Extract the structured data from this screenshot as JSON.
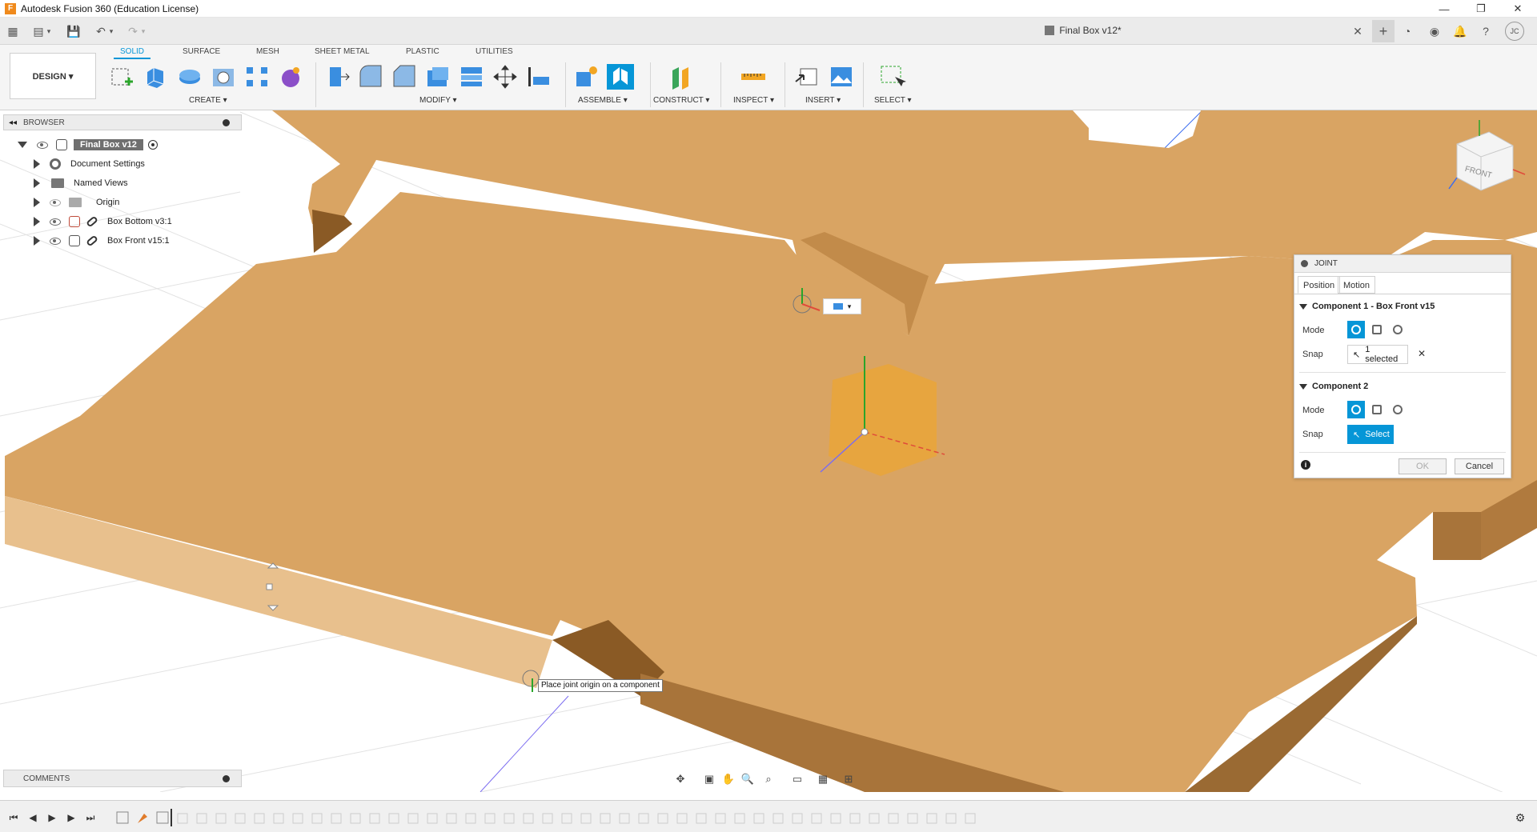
{
  "window": {
    "app_title": "Autodesk Fusion 360 (Education License)",
    "app_icon": "F"
  },
  "document": {
    "title": "Final Box v12*"
  },
  "ribbon": {
    "workspace": "DESIGN ▾",
    "tabs": [
      "SOLID",
      "SURFACE",
      "MESH",
      "SHEET METAL",
      "PLASTIC",
      "UTILITIES"
    ],
    "active_tab": "SOLID",
    "groups": {
      "create": "CREATE ▾",
      "modify": "MODIFY ▾",
      "assemble": "ASSEMBLE ▾",
      "construct": "CONSTRUCT ▾",
      "inspect": "INSPECT ▾",
      "insert": "INSERT ▾",
      "select": "SELECT ▾"
    },
    "accent": "#0696d7"
  },
  "browser": {
    "header": "BROWSER",
    "root": "Final Box v12",
    "items": [
      {
        "label": "Document Settings",
        "icon": "gear-icon"
      },
      {
        "label": "Named Views",
        "icon": "folder-icon"
      },
      {
        "label": "Origin",
        "icon": "folder-icon"
      },
      {
        "label": "Box Bottom v3:1",
        "icon": "component-icon"
      },
      {
        "label": "Box Front v15:1",
        "icon": "component-icon"
      }
    ]
  },
  "comments": {
    "header": "COMMENTS"
  },
  "joint_dialog": {
    "title": "JOINT",
    "tabs": [
      "Position",
      "Motion"
    ],
    "active_tab": "Position",
    "component1": {
      "title": "Component 1 - Box Front v15",
      "mode_label": "Mode",
      "snap_label": "Snap",
      "snap_value": "1 selected"
    },
    "component2": {
      "title": "Component 2",
      "mode_label": "Mode",
      "snap_label": "Snap",
      "snap_value": "Select"
    },
    "ok": "OK",
    "cancel": "Cancel"
  },
  "viewport": {
    "tooltip": "Place joint origin on a component",
    "viewcube_face": "FRONT",
    "wood_color": "#d9a463",
    "grid_color": "#dcdcdc"
  }
}
